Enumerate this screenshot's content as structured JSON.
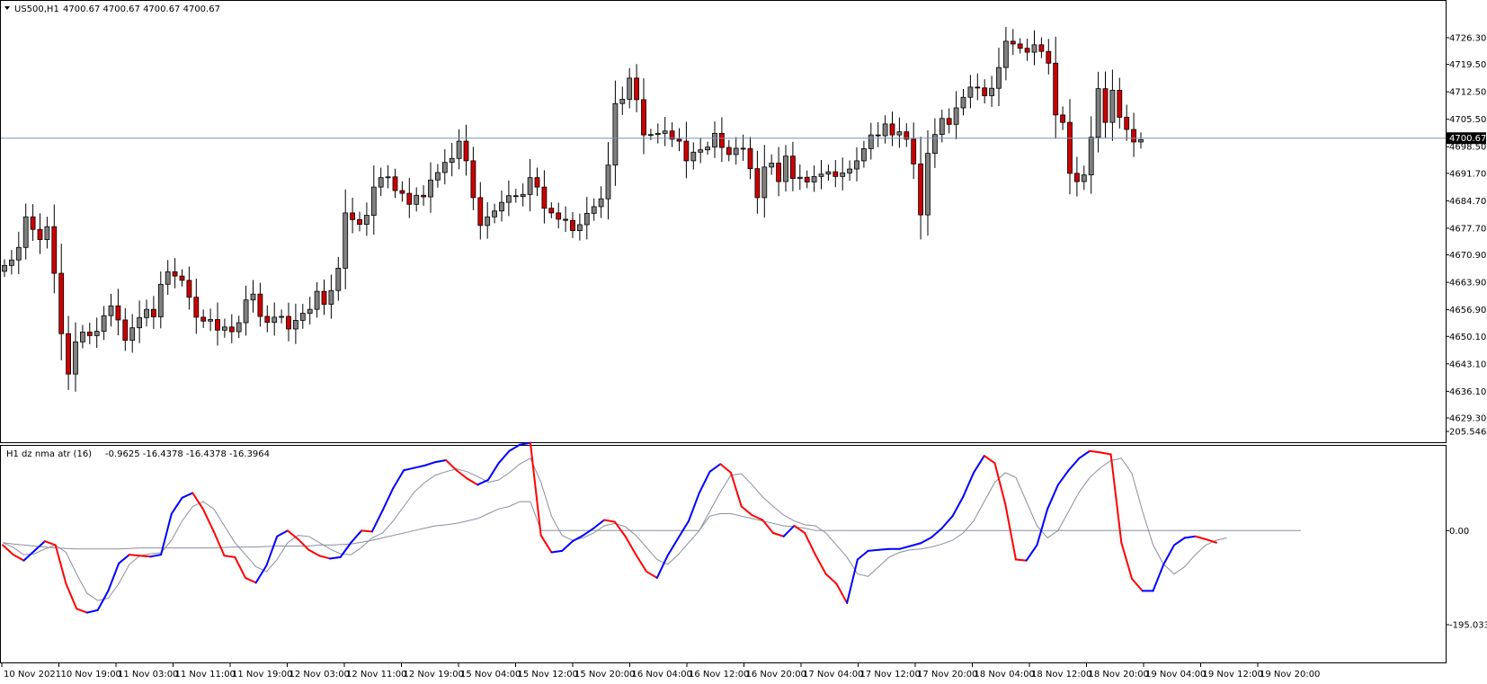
{
  "main_title": "US500,H1",
  "main_values": "4700.67 4700.67 4700.67 4700.67",
  "indicator_title": "H1 dz nma atr (16)",
  "indicator_values": "-0.9625 -16.4378 -16.4378 -16.3964",
  "bid_price": "4700.67",
  "colors": {
    "bull_fill": "#808080",
    "bear_fill": "#cc0000",
    "candle_outline": "#000000",
    "bid_line": "#7f93b0",
    "rising": "#0000ff",
    "falling": "#ff0000",
    "signal": "#8a8f9e",
    "atr_line": "#8a8f9e"
  },
  "chart_data": [
    {
      "type": "candlestick",
      "symbol": "US500",
      "timeframe": "H1",
      "ylim": [
        4629.3,
        4729.5
      ],
      "y_ticks": [
        "4726.30",
        "4719.50",
        "4712.50",
        "4705.50",
        "4698.50",
        "4691.70",
        "4684.70",
        "4677.70",
        "4670.90",
        "4663.90",
        "4656.90",
        "4650.10",
        "4643.10",
        "4636.10",
        "4629.30"
      ],
      "last_price": 4700.67,
      "closes": [
        4668.2,
        4669.6,
        4672.8,
        4680.6,
        4677.4,
        4674.8,
        4678.1,
        4666.2,
        4650.8,
        4640.5,
        4648.7,
        4651.2,
        4650.3,
        4651.4,
        4655.4,
        4657.9,
        4654.3,
        4649.1,
        4652.3,
        4654.9,
        4657.0,
        4655.1,
        4663.4,
        4666.6,
        4665.5,
        4664.4,
        4660.1,
        4655.0,
        4654.0,
        4654.4,
        4651.7,
        4652.5,
        4651.3,
        4653.6,
        4659.4,
        4660.9,
        4655.2,
        4653.7,
        4655.0,
        4655.2,
        4652.0,
        4654.2,
        4656.0,
        4657.0,
        4661.6,
        4658.3,
        4661.8,
        4667.5,
        4681.6,
        4679.9,
        4678.7,
        4681.0,
        4688.2,
        4690.6,
        4690.8,
        4687.3,
        4686.6,
        4683.8,
        4686.1,
        4685.7,
        4690.0,
        4691.9,
        4694.5,
        4695.5,
        4699.9,
        4694.9,
        4685.5,
        4678.4,
        4680.6,
        4682.1,
        4684.3,
        4686.0,
        4685.8,
        4686.3,
        4690.6,
        4688.2,
        4682.8,
        4681.6,
        4680.0,
        4679.7,
        4677.1,
        4678.6,
        4681.5,
        4683.2,
        4685.2,
        4693.8,
        4709.5,
        4710.6,
        4716.0,
        4710.5,
        4701.5,
        4701.6,
        4701.9,
        4702.5,
        4700.4,
        4699.9,
        4694.9,
        4697.1,
        4697.7,
        4698.4,
        4701.9,
        4698.3,
        4696.5,
        4698.1,
        4698.0,
        4692.9,
        4685.5,
        4693.3,
        4694.3,
        4689.6,
        4696.1,
        4690.4,
        4690.7,
        4689.5,
        4690.9,
        4691.5,
        4692.1,
        4690.9,
        4691.8,
        4692.8,
        4694.9,
        4698.0,
        4701.5,
        4701.3,
        4704.3,
        4701.5,
        4702.3,
        4700.4,
        4694.1,
        4681.1,
        4696.8,
        4701.6,
        4705.7,
        4704.2,
        4708.4,
        4711.1,
        4713.7,
        4713.5,
        4711.5,
        4713.4,
        4718.7,
        4725.4,
        4724.7,
        4723.6,
        4722.6,
        4724.5,
        4722.8,
        4719.8,
        4706.6,
        4704.7,
        4691.7,
        4689.6,
        4691.3,
        4700.9,
        4713.3,
        4704.7,
        4712.9,
        4706.0,
        4702.9,
        4699.7,
        4700.3
      ],
      "x_labels": [
        "10 Nov 2021",
        "10 Nov 19:00",
        "11 Nov 03:00",
        "11 Nov 11:00",
        "11 Nov 19:00",
        "12 Nov 03:00",
        "12 Nov 11:00",
        "12 Nov 19:00",
        "15 Nov 04:00",
        "15 Nov 12:00",
        "15 Nov 20:00",
        "16 Nov 04:00",
        "16 Nov 12:00",
        "16 Nov 20:00",
        "17 Nov 04:00",
        "17 Nov 12:00",
        "17 Nov 20:00",
        "18 Nov 04:00",
        "18 Nov 12:00",
        "18 Nov 20:00",
        "19 Nov 04:00",
        "19 Nov 12:00",
        "19 Nov 20:00"
      ]
    },
    {
      "type": "line",
      "title": "H1 dz nma atr (16)",
      "ylim": [
        -195.0336,
        205.5464
      ],
      "y_ticks": [
        "205.5464",
        "0.00",
        "-195.0336"
      ],
      "series": [
        {
          "values": [
            -30,
            -50,
            -62,
            -42,
            -22,
            -30,
            -110,
            -162,
            -170,
            -165,
            -125,
            -68,
            -50,
            -52,
            -54,
            -50,
            35,
            68,
            78,
            44,
            -2,
            -52,
            -55,
            -98,
            -108,
            -72,
            -12,
            0,
            -18,
            -40,
            -52,
            -58,
            -55,
            -25,
            0,
            -2,
            42,
            88,
            125,
            130,
            135,
            142,
            146,
            125,
            108,
            95,
            105,
            140,
            165,
            178,
            182,
            -10,
            -45,
            -42,
            -22,
            -10,
            5,
            22,
            18,
            -12,
            -50,
            -85,
            -98,
            -52,
            -16,
            20,
            78,
            122,
            138,
            120,
            50,
            32,
            22,
            -5,
            -12,
            10,
            -5,
            -50,
            -90,
            -110,
            -150,
            -60,
            -42,
            -40,
            -38,
            -38,
            -32,
            -26,
            -14,
            5,
            30,
            70,
            120,
            155,
            140,
            55,
            -60,
            -62,
            -30,
            45,
            95,
            125,
            150,
            165,
            162,
            158,
            -25,
            -100,
            -125,
            -125,
            -70,
            -30,
            -15,
            -12,
            -18,
            -25
          ]
        },
        {
          "values": [
            -25,
            -35,
            -50,
            -48,
            -38,
            -30,
            -45,
            -90,
            -130,
            -145,
            -140,
            -110,
            -70,
            -52,
            -48,
            -46,
            -20,
            20,
            50,
            60,
            45,
            10,
            -25,
            -50,
            -75,
            -85,
            -60,
            -25,
            -10,
            -12,
            -25,
            -38,
            -48,
            -50,
            -35,
            -15,
            -5,
            20,
            50,
            80,
            100,
            115,
            122,
            128,
            122,
            112,
            100,
            105,
            120,
            138,
            150,
            100,
            30,
            -10,
            -20,
            -15,
            -5,
            10,
            15,
            8,
            -10,
            -35,
            -60,
            -70,
            -50,
            -25,
            0,
            40,
            80,
            115,
            118,
            95,
            70,
            50,
            32,
            20,
            12,
            10,
            -5,
            -30,
            -55,
            -90,
            -95,
            -75,
            -55,
            -45,
            -40,
            -38,
            -34,
            -28,
            -20,
            -5,
            20,
            60,
            100,
            120,
            110,
            60,
            10,
            -15,
            0,
            40,
            80,
            110,
            130,
            145,
            150,
            118,
            40,
            -30,
            -70,
            -90,
            -75,
            -50,
            -30,
            -20,
            -15
          ]
        },
        {
          "values": [
            -25,
            -28,
            -30,
            -32,
            -34,
            -36,
            -37,
            -38,
            -38,
            -38,
            -38,
            -38,
            -37,
            -36,
            -36,
            -36,
            -36,
            -36,
            -36,
            -36,
            -36,
            -35,
            -34,
            -34,
            -34,
            -33,
            -32,
            -32,
            -32,
            -32,
            -30,
            -30,
            -29,
            -28,
            -24,
            -20,
            -15,
            -10,
            -5,
            0,
            5,
            10,
            12,
            15,
            20,
            25,
            35,
            45,
            50,
            60,
            60,
            0,
            0,
            0,
            0,
            0,
            0,
            0,
            0,
            0,
            0,
            0,
            0,
            0,
            0,
            0,
            0,
            30,
            35,
            35,
            30,
            25,
            20,
            15,
            10,
            8,
            5,
            0,
            0,
            0,
            0,
            0,
            0,
            0,
            0,
            0,
            0,
            0,
            0,
            0,
            0,
            0,
            0,
            0,
            0,
            0,
            0,
            0,
            0,
            0,
            0,
            0,
            0,
            0,
            0,
            0,
            0,
            0,
            0,
            0,
            0,
            0,
            0,
            0,
            0,
            0,
            0,
            0,
            0,
            0,
            0,
            0,
            0,
            0
          ]
        }
      ]
    }
  ]
}
